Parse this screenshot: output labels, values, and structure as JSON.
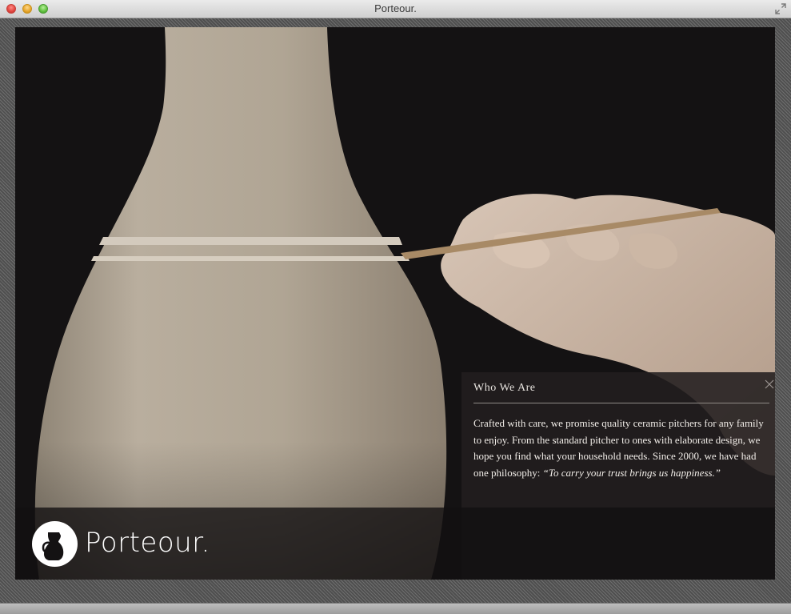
{
  "window": {
    "title": "Porteour."
  },
  "info_panel": {
    "heading": "Who We Are",
    "body_text": "Crafted with care, we promise quality ceramic pitchers for any family to enjoy. From the standard pitcher to ones with elaborate design, we hope you find what your household needs. Since 2000, we have had one philosophy: ",
    "quote": "“To carry your trust brings us happiness.”",
    "close_icon": "close-icon"
  },
  "brand": {
    "name": "Porteour.",
    "logo_icon": "pitcher-icon"
  },
  "colors": {
    "stage_background": "#141213",
    "panel_background": "#221e1f",
    "vase": "#b5aa9b",
    "text": "#f1ede8"
  }
}
